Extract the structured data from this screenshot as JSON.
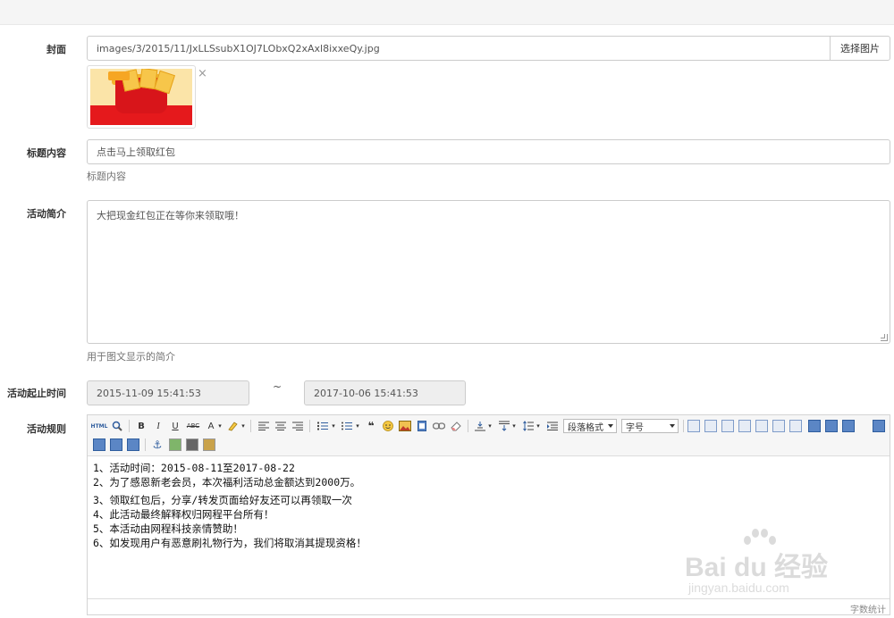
{
  "form": {
    "cover": {
      "label": "封面",
      "value": "images/3/2015/11/JxLLSsubX1OJ7LObxQ2xAxl8ixxeQy.jpg",
      "button": "选择图片",
      "remove": "×"
    },
    "title": {
      "label": "标题内容",
      "value": "点击马上领取红包",
      "help": "标题内容"
    },
    "intro": {
      "label": "活动简介",
      "value": "大把现金红包正在等你来领取哦！",
      "help": "用于图文显示的简介"
    },
    "period": {
      "label": "活动起止时间",
      "start": "2015-11-09 15:41:53",
      "separator": "~",
      "end": "2017-10-06 15:41:53"
    },
    "rules": {
      "label": "活动规则",
      "toolbar": {
        "paragraph_format": "段落格式",
        "font_size": "字号",
        "html": "HTML",
        "bold": "B",
        "italic": "I",
        "underline": "U",
        "strike": "ABC",
        "font_color": "A",
        "quote": "❝"
      },
      "lines": [
        "1、活动时间：2015-08-11至2017-08-22",
        "2、为了感恩新老会员，本次福利活动总金额达到2000万。",
        "3、领取红包后，分享/转发页面给好友还可以再领取一次",
        "4、此活动最终解释权归网程平台所有！",
        "5、本活动由网程科技亲情赞助！",
        "6、如发现用户有恶意刷礼物行为，我们将取消其提现资格！"
      ],
      "word_count": "字数统计"
    }
  },
  "watermark": {
    "brand": "Bai du 经验",
    "url": "jingyan.baidu.com"
  }
}
